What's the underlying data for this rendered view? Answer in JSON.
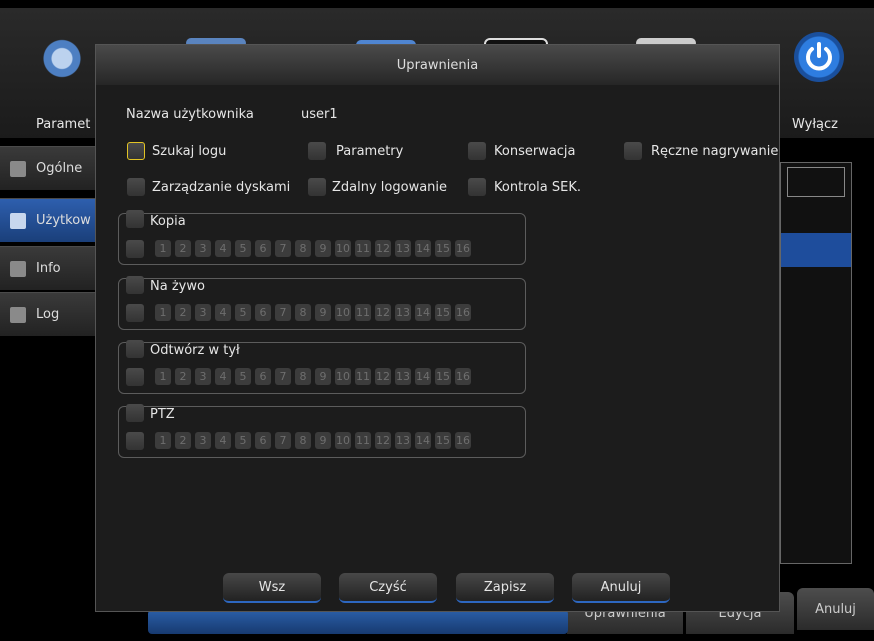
{
  "dialog": {
    "title": "Uprawnienia",
    "username_label": "Nazwa użytkownika",
    "username_value": "user1"
  },
  "background": {
    "top_labels": {
      "params": "Paramet",
      "shutdown": "Wyłącz"
    },
    "sidebar": [
      {
        "label": "Ogólne",
        "icon": "gear-icon"
      },
      {
        "label": "Użytkow",
        "icon": "user-icon"
      },
      {
        "label": "Info",
        "icon": "info-icon"
      },
      {
        "label": "Log",
        "icon": "log-icon"
      }
    ],
    "bottom_buttons": [
      "Uprawnienia",
      "Edycja",
      "Anuluj"
    ]
  },
  "permissions": [
    {
      "label": "Szukaj logu",
      "checked": false,
      "focused": true
    },
    {
      "label": "Parametry",
      "checked": false
    },
    {
      "label": "Konserwacja",
      "checked": false
    },
    {
      "label": "Ręczne nagrywanie",
      "checked": false
    },
    {
      "label": "Zarządzanie dyskami",
      "checked": false
    },
    {
      "label": "Zdalny logowanie",
      "checked": false
    },
    {
      "label": "Kontrola SEK.",
      "checked": false
    }
  ],
  "groups": [
    {
      "label": "Kopia"
    },
    {
      "label": "Na żywo"
    },
    {
      "label": "Odtwórz w tył"
    },
    {
      "label": "PTZ"
    }
  ],
  "channels": [
    "1",
    "2",
    "3",
    "4",
    "5",
    "6",
    "7",
    "8",
    "9",
    "10",
    "11",
    "12",
    "13",
    "14",
    "15",
    "16"
  ],
  "buttons": {
    "all": "Wsz",
    "clear": "Czyść",
    "save": "Zapisz",
    "cancel": "Anuluj"
  }
}
